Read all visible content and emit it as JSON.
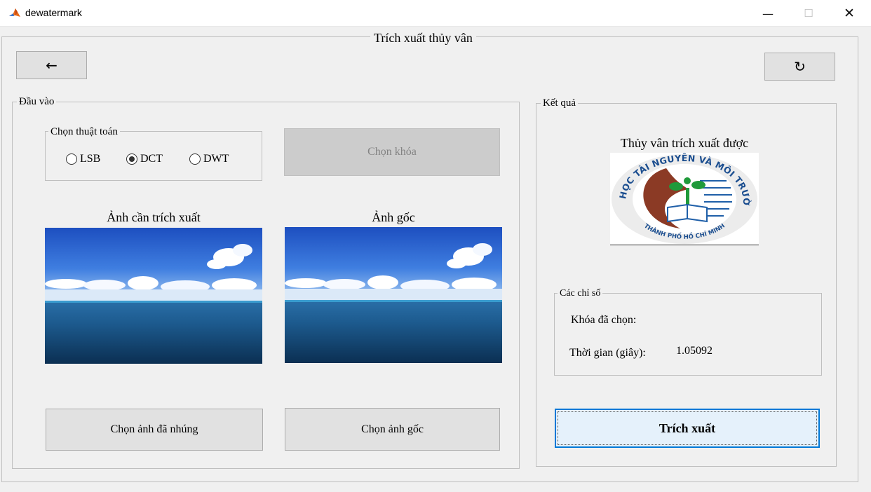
{
  "window": {
    "title": "dewatermark",
    "minimize_glyph": "—",
    "maximize_glyph": "☐",
    "close_glyph": "✕"
  },
  "main": {
    "title": "Trích xuất thủy vân",
    "back_glyph": "←",
    "reset_glyph": "↻"
  },
  "input": {
    "title": "Đầu vào",
    "algorithm": {
      "title": "Chọn thuật toán",
      "options": [
        "LSB",
        "DCT",
        "DWT"
      ],
      "selected": "DCT"
    },
    "key_button": "Chọn khóa",
    "embedded_image_label": "Ảnh cần trích xuất",
    "original_image_label": "Ảnh gốc",
    "choose_embedded_button": "Chọn ảnh đã nhúng",
    "choose_original_button": "Chọn ảnh gốc"
  },
  "result": {
    "title": "Kết quả",
    "watermark_label": "Thủy vân trích xuất được",
    "logo_text_top": "ĐẠI HỌC TÀI NGUYÊN VÀ MÔI TRƯỜNG",
    "logo_text_bottom": "THÀNH PHỐ HỒ CHÍ MINH",
    "metrics": {
      "title": "Các chỉ số",
      "key_label": "Khóa đã chọn:",
      "key_value": "",
      "time_label": "Thời gian (giây):",
      "time_value": "1.05092"
    },
    "extract_button": "Trích xuất"
  },
  "colors": {
    "accent": "#0078d7",
    "extract_bg": "#e5f1fb",
    "logo_red": "#8b3a25",
    "logo_blue": "#1f5fa8",
    "logo_green": "#1f9a3a"
  }
}
